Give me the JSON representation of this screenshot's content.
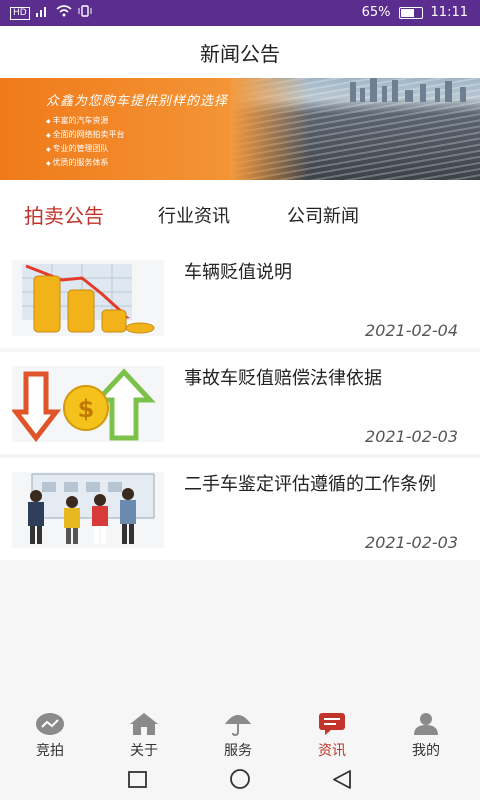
{
  "status_bar": {
    "left_icons": [
      "hd-icon",
      "signal-icon",
      "wifi-icon",
      "vibrate-icon"
    ],
    "battery_percent": "65%",
    "time": "11:11"
  },
  "header": {
    "title": "新闻公告"
  },
  "banner": {
    "slogan": "众鑫为您购车提供别样的选择",
    "bullets": [
      "丰富的汽车资源",
      "全面的网络拍卖平台",
      "专业的管理团队",
      "优质的服务体系"
    ]
  },
  "tabs": [
    {
      "label": "拍卖公告",
      "active": true
    },
    {
      "label": "行业资讯",
      "active": false
    },
    {
      "label": "公司新闻",
      "active": false
    }
  ],
  "articles": [
    {
      "title": "车辆贬值说明",
      "date": "2021-02-04",
      "thumb": "coins-chart-icon"
    },
    {
      "title": "事故车贬值赔偿法律依据",
      "date": "2021-02-03",
      "thumb": "arrows-dollar-icon"
    },
    {
      "title": "二手车鉴定评估遵循的工作条例",
      "date": "2021-02-03",
      "thumb": "people-board-icon"
    }
  ],
  "bottom_nav": [
    {
      "label": "竞拍",
      "icon": "bid-icon",
      "active": false
    },
    {
      "label": "关于",
      "icon": "home-icon",
      "active": false
    },
    {
      "label": "服务",
      "icon": "umbrella-icon",
      "active": false
    },
    {
      "label": "资讯",
      "icon": "message-icon",
      "active": true
    },
    {
      "label": "我的",
      "icon": "user-icon",
      "active": false
    }
  ],
  "colors": {
    "status_bar": "#5a2d8f",
    "accent": "#c2342a",
    "banner_orange": "#f07a1a"
  }
}
